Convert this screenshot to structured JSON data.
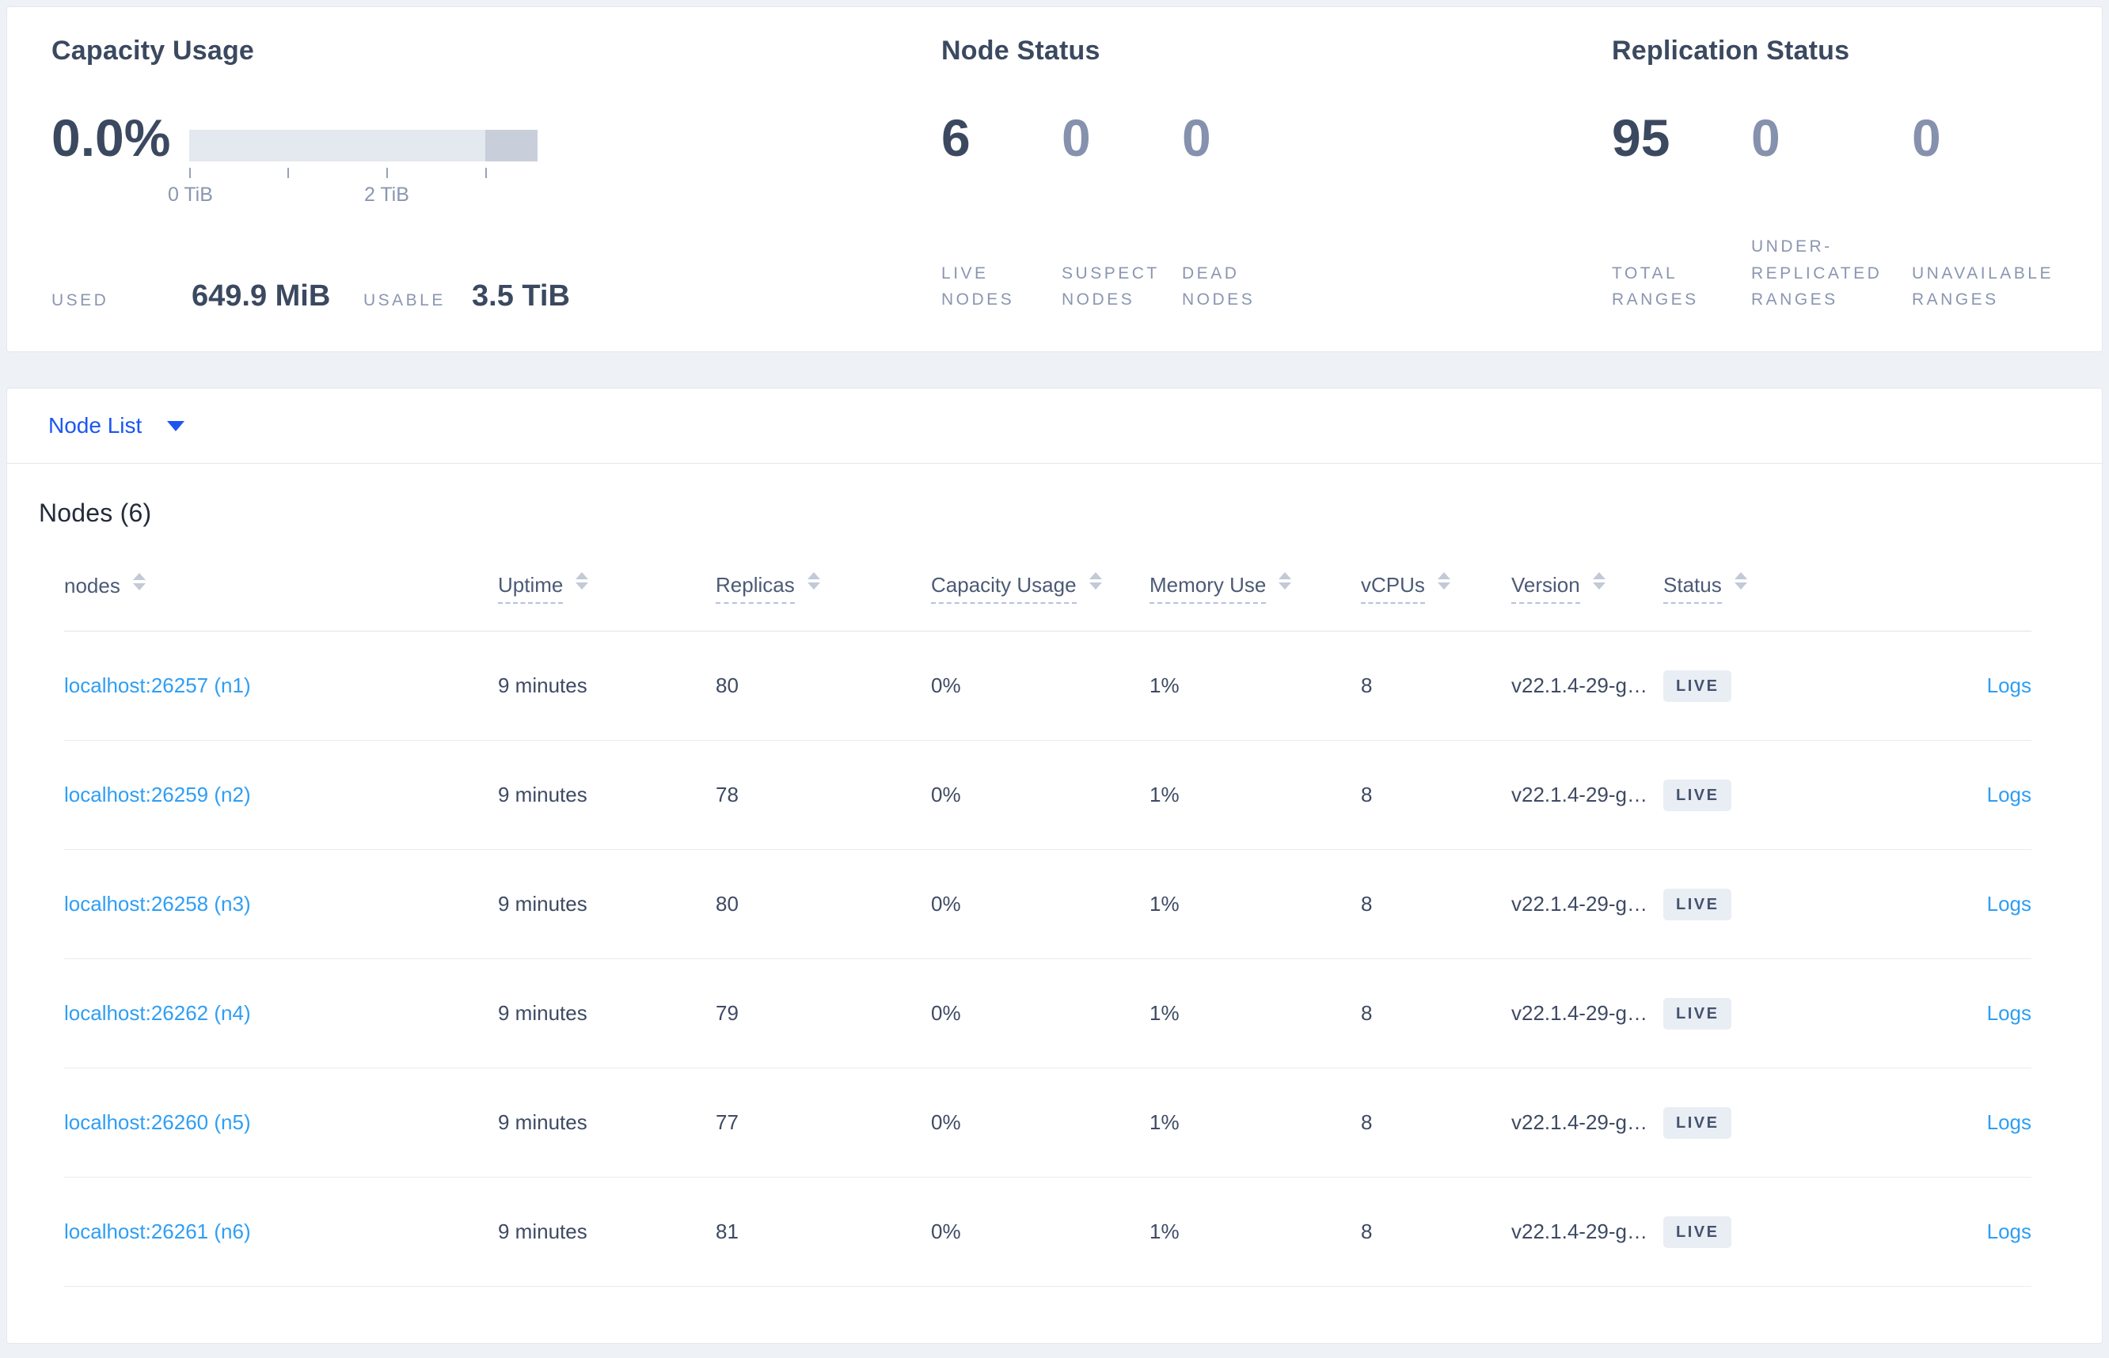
{
  "colors": {
    "page_background": "#eef1f6",
    "card_background": "#ffffff",
    "accent_blue": "#1b56f2",
    "link_blue": "#2f9ef4",
    "heading_dark": "#3b4960",
    "muted_stat": "#8591ad",
    "label_gray": "#8a96b0",
    "badge_background": "#e9edf4",
    "badge_text": "#44536d",
    "bar_light": "#e4e8ef",
    "bar_dark": "#c9cfda"
  },
  "summary": {
    "capacity": {
      "title": "Capacity Usage",
      "percent": "0.0%",
      "tick_labels": [
        "0 TiB",
        "2 TiB"
      ],
      "used_label": "USED",
      "used_value": "649.9 MiB",
      "usable_label": "USABLE",
      "usable_value": "3.5 TiB"
    },
    "node_status": {
      "title": "Node Status",
      "stats": [
        {
          "value": "6",
          "label": "LIVE NODES"
        },
        {
          "value": "0",
          "label": "SUSPECT NODES"
        },
        {
          "value": "0",
          "label": "DEAD NODES"
        }
      ]
    },
    "replication": {
      "title": "Replication Status",
      "stats": [
        {
          "value": "95",
          "label": "TOTAL RANGES"
        },
        {
          "value": "0",
          "label": "UNDER-REPLICATED RANGES"
        },
        {
          "value": "0",
          "label": "UNAVAILABLE RANGES"
        }
      ]
    }
  },
  "view_selector": {
    "selected": "Node List"
  },
  "nodes_table": {
    "title": "Nodes (6)",
    "columns": {
      "nodes": "nodes",
      "uptime": "Uptime",
      "replicas": "Replicas",
      "capacity": "Capacity Usage",
      "memory": "Memory Use",
      "vcpus": "vCPUs",
      "version": "Version",
      "status": "Status"
    },
    "rows": [
      {
        "node": "localhost:26257 (n1)",
        "uptime": "9 minutes",
        "replicas": "80",
        "capacity_usage": "0%",
        "memory_use": "1%",
        "vcpus": "8",
        "version": "v22.1.4-29-g…",
        "status": "LIVE",
        "logs_label": "Logs"
      },
      {
        "node": "localhost:26259 (n2)",
        "uptime": "9 minutes",
        "replicas": "78",
        "capacity_usage": "0%",
        "memory_use": "1%",
        "vcpus": "8",
        "version": "v22.1.4-29-g…",
        "status": "LIVE",
        "logs_label": "Logs"
      },
      {
        "node": "localhost:26258 (n3)",
        "uptime": "9 minutes",
        "replicas": "80",
        "capacity_usage": "0%",
        "memory_use": "1%",
        "vcpus": "8",
        "version": "v22.1.4-29-g…",
        "status": "LIVE",
        "logs_label": "Logs"
      },
      {
        "node": "localhost:26262 (n4)",
        "uptime": "9 minutes",
        "replicas": "79",
        "capacity_usage": "0%",
        "memory_use": "1%",
        "vcpus": "8",
        "version": "v22.1.4-29-g…",
        "status": "LIVE",
        "logs_label": "Logs"
      },
      {
        "node": "localhost:26260 (n5)",
        "uptime": "9 minutes",
        "replicas": "77",
        "capacity_usage": "0%",
        "memory_use": "1%",
        "vcpus": "8",
        "version": "v22.1.4-29-g…",
        "status": "LIVE",
        "logs_label": "Logs"
      },
      {
        "node": "localhost:26261 (n6)",
        "uptime": "9 minutes",
        "replicas": "81",
        "capacity_usage": "0%",
        "memory_use": "1%",
        "vcpus": "8",
        "version": "v22.1.4-29-g…",
        "status": "LIVE",
        "logs_label": "Logs"
      }
    ]
  }
}
